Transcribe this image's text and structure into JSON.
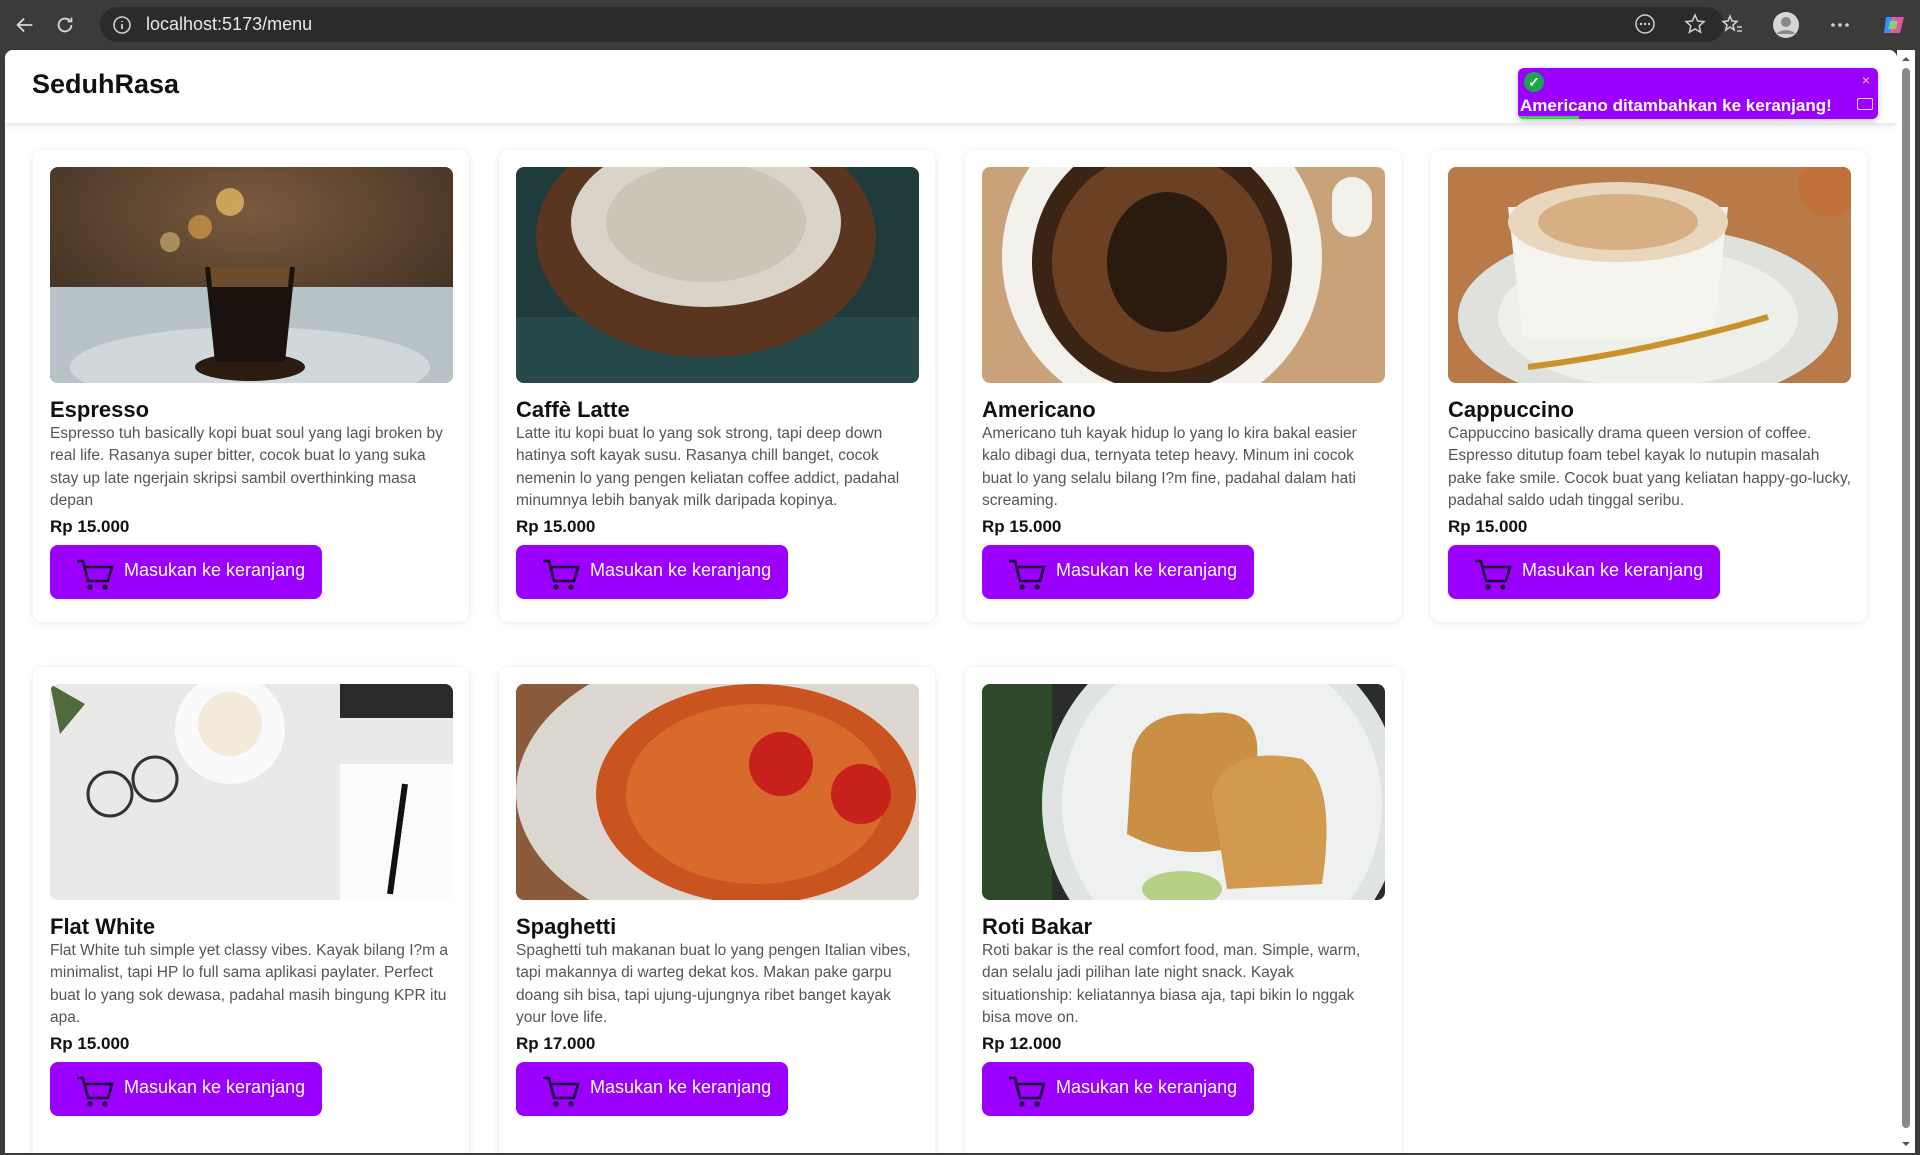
{
  "browser": {
    "url": "localhost:5173/menu"
  },
  "app": {
    "brand": "SeduhRasa"
  },
  "toast": {
    "message": "Americano ditambahkan ke keranjang!",
    "close": "×",
    "progress": 0.17,
    "colors": {
      "background": "#9b00ff",
      "success": "#1aa64a"
    }
  },
  "menu": {
    "button_label": "Masukan ke keranjang",
    "items": [
      {
        "name": "Espresso",
        "desc": "Espresso tuh basically kopi buat soul yang lagi broken by real life. Rasanya super bitter, cocok buat lo yang suka stay up late ngerjain skripsi sambil overthinking masa depan",
        "price": "Rp 15.000",
        "image": "espresso-photo"
      },
      {
        "name": "Caffè Latte",
        "desc": "Latte itu kopi buat lo yang sok strong, tapi deep down hatinya soft kayak susu. Rasanya chill banget, cocok nemenin lo yang pengen keliatan coffee addict, padahal minumnya lebih banyak milk daripada kopinya.",
        "price": "Rp 15.000",
        "image": "latte-photo"
      },
      {
        "name": "Americano",
        "desc": "Americano tuh kayak hidup lo yang lo kira bakal easier kalo dibagi dua, ternyata tetep heavy. Minum ini cocok buat lo yang selalu bilang I?m fine, padahal dalam hati screaming.",
        "price": "Rp 15.000",
        "image": "americano-photo"
      },
      {
        "name": "Cappuccino",
        "desc": "Cappuccino basically drama queen version of coffee. Espresso ditutup foam tebel kayak lo nutupin masalah pake fake smile. Cocok buat yang keliatan happy-go-lucky, padahal saldo udah tinggal seribu.",
        "price": "Rp 15.000",
        "image": "cappuccino-photo"
      },
      {
        "name": "Flat White",
        "desc": "Flat White tuh simple yet classy vibes. Kayak bilang I?m a minimalist, tapi HP lo full sama aplikasi paylater. Perfect buat lo yang sok dewasa, padahal masih bingung KPR itu apa.",
        "price": "Rp 15.000",
        "image": "flat-white-photo"
      },
      {
        "name": "Spaghetti",
        "desc": "Spaghetti tuh makanan buat lo yang pengen Italian vibes, tapi makannya di warteg dekat kos. Makan pake garpu doang sih bisa, tapi ujung-ujungnya ribet banget kayak your love life.",
        "price": "Rp 17.000",
        "image": "spaghetti-photo"
      },
      {
        "name": "Roti Bakar",
        "desc": "Roti bakar is the real comfort food, man. Simple, warm, dan selalu jadi pilihan late night snack. Kayak situationship: keliatannya biasa aja, tapi bikin lo nggak bisa move on.",
        "price": "Rp 12.000",
        "image": "roti-bakar-photo"
      }
    ]
  },
  "colors": {
    "accent": "#9b00ff"
  }
}
